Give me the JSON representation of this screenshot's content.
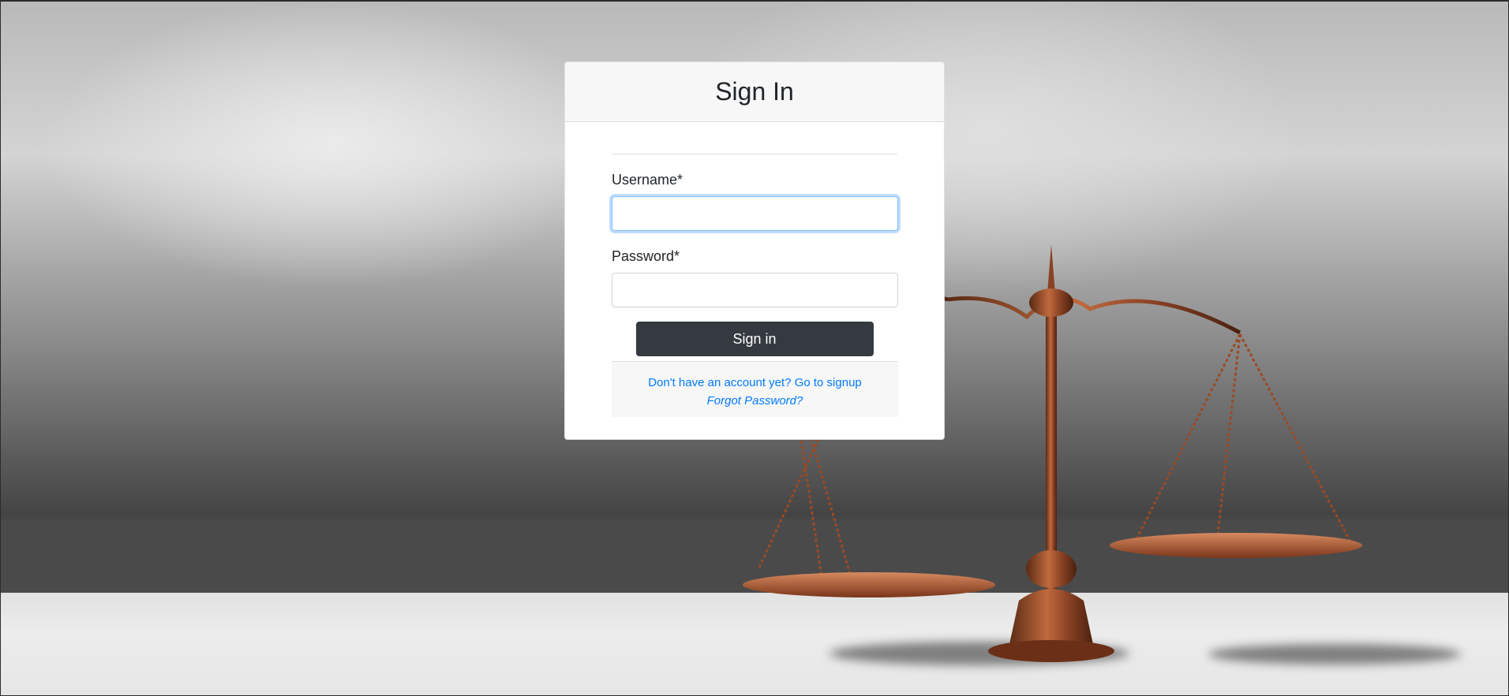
{
  "card": {
    "title": "Sign In"
  },
  "form": {
    "username": {
      "label": "Username*",
      "value": "",
      "placeholder": ""
    },
    "password": {
      "label": "Password*",
      "value": "",
      "placeholder": ""
    },
    "submit_label": "Sign in"
  },
  "footer": {
    "signup_link": "Don't have an account yet? Go to signup",
    "forgot_link": "Forgot Password?"
  },
  "background": {
    "image_subject": "bronze-scales-of-justice"
  },
  "colors": {
    "primary_button": "#343a40",
    "link": "#007bff",
    "focus_ring": "#80bdff"
  }
}
